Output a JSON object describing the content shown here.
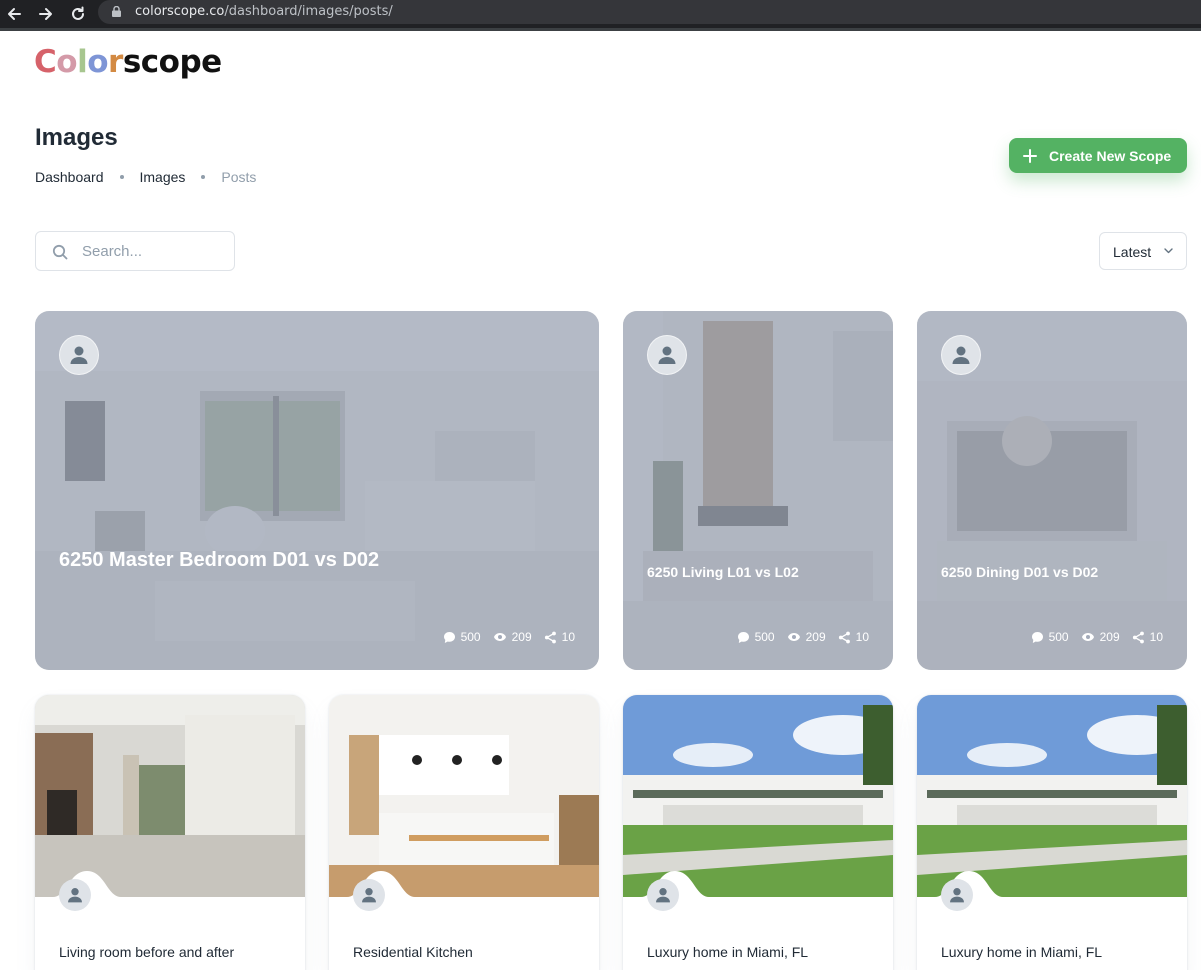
{
  "browser": {
    "url_host": "colorscope.co",
    "url_path": "/dashboard/images/posts/"
  },
  "logo": {
    "letters": [
      {
        "char": "C",
        "color": "#d6626a"
      },
      {
        "char": "o",
        "color": "#d49aa8"
      },
      {
        "char": "l",
        "color": "#a7c68f"
      },
      {
        "char": "o",
        "color": "#7e95d6"
      },
      {
        "char": "r",
        "color": "#d38a43"
      },
      {
        "char": "scope",
        "color": "#111111"
      }
    ]
  },
  "header": {
    "title": "Images",
    "breadcrumbs": [
      "Dashboard",
      "Images",
      "Posts"
    ],
    "create_button": "Create New Scope"
  },
  "toolbar": {
    "search_placeholder": "Search...",
    "search_value": "",
    "sort_selected": "Latest"
  },
  "colors": {
    "accent_green": "#54b263",
    "text_primary": "#212b36",
    "text_muted": "#919eab"
  },
  "featured_posts": [
    {
      "title": "6250 Master Bedroom D01 vs D02",
      "comments": "500",
      "views": "209",
      "shares": "10"
    },
    {
      "title": "6250 Living L01 vs L02",
      "comments": "500",
      "views": "209",
      "shares": "10"
    },
    {
      "title": "6250 Dining D01 vs D02",
      "comments": "500",
      "views": "209",
      "shares": "10"
    }
  ],
  "posts": [
    {
      "title": "Living room before and after"
    },
    {
      "title": "Residential Kitchen"
    },
    {
      "title": "Luxury home in Miami, FL"
    },
    {
      "title": "Luxury home in Miami, FL"
    }
  ],
  "icons": {
    "back": "arrow-left-icon",
    "forward": "arrow-right-icon",
    "reload": "reload-icon",
    "lock": "lock-icon",
    "search": "search-icon",
    "plus": "plus-icon",
    "chevron": "chevron-down-icon",
    "avatar": "person-icon",
    "comment": "comment-icon",
    "view": "eye-icon",
    "share": "share-icon"
  }
}
